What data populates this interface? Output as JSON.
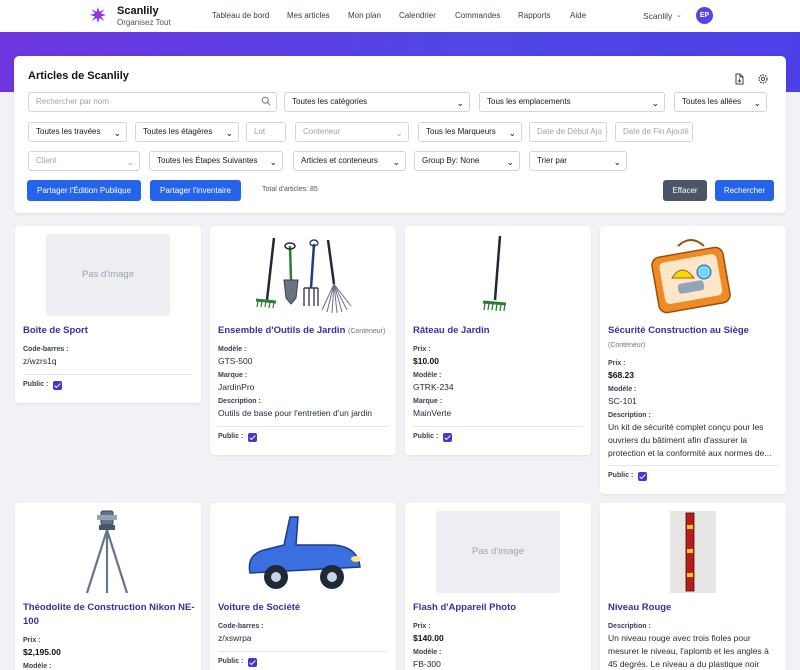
{
  "app": {
    "brand": "Scanlily",
    "tagline": "Organisez Tout"
  },
  "nav": [
    "Tableau de bord",
    "Mes articles",
    "Mon plan",
    "Calendrier",
    "Commandes",
    "Rapports",
    "Aide"
  ],
  "account": {
    "name": "Scanlily",
    "initials": "EP"
  },
  "panel": {
    "title": "Articles de Scanlily",
    "search_placeholder": "Rechercher par nom",
    "categories": "Toutes les catégories",
    "locations": "Tous les emplacements",
    "aisles": "Toutes les allées",
    "bays": "Toutes les travées",
    "shelves": "Toutes les étagères",
    "lot_placeholder": "Lot",
    "container_placeholder": "Conteneur",
    "markers": "Tous les Marqueurs",
    "date_start_placeholder": "Date de Début Ajo",
    "date_end_placeholder": "Date de Fin Ajouté",
    "client_placeholder": "Client",
    "next_steps": "Toutes les Étapes Suivantes",
    "items_containers": "Articles et conteneurs",
    "group_by": "Group By: None",
    "sort_by": "Trier par",
    "share_public_edit": "Partager l'Édition Publique",
    "share_inventory": "Partager l'inventaire",
    "total": "Total d'articles: 85",
    "clear": "Effacer",
    "search": "Rechercher"
  },
  "labels": {
    "barcode": "Code-barres :",
    "model": "Modèle :",
    "brand": "Marque :",
    "description": "Description :",
    "price": "Prix :",
    "public": "Public :",
    "no_image": "Pas d'image",
    "container_tag": "(Conteneur)"
  },
  "cards": [
    {
      "title": "Boîte de Sport",
      "barcode": "z/wzrs1q",
      "public": true,
      "image": "none"
    },
    {
      "title": "Ensemble d'Outils de Jardin",
      "model": "GTS-500",
      "brand": "JardinPro",
      "description": "Outils de base pour l'entretien d'un jardin",
      "public": true,
      "image": "garden-tools"
    },
    {
      "title": "Râteau de Jardin",
      "price": "$10.00",
      "model": "GTRK-234",
      "brand": "MainVerte",
      "public": true,
      "image": "rake"
    },
    {
      "title": "Sécurité Construction au Siège",
      "price": "$68.23",
      "model": "SC-101",
      "description": "Un kit de sécurité complet conçu pour les ouvriers du bâtiment afin d'assurer la protection et la conformité aux normes de...",
      "public": true,
      "image": "safety-kit"
    },
    {
      "title": "Théodolite de Construction Nikon NE-100",
      "price": "$2,195.00",
      "model_label_only": true,
      "image": "theodolite"
    },
    {
      "title": "Voiture de Société",
      "barcode": "z/xswrpa",
      "public": true,
      "image": "car"
    },
    {
      "title": "Flash d'Appareil Photo",
      "price": "$140.00",
      "model": "FB-300",
      "image": "none"
    },
    {
      "title": "Niveau Rouge",
      "description": "Un niveau rouge avec trois fioles pour mesurer le niveau, l'aplomb et les angles à 45 degrés. Le niveau a du plastique noir autour...",
      "image": "level"
    }
  ]
}
